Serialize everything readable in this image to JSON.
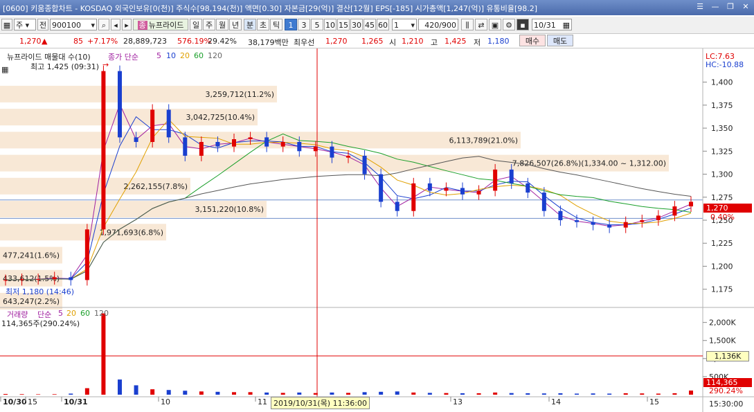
{
  "title": "[0600] 키움종합차트 - KOSDAQ 외국인보유[0(천)] 주식수[98,194(천)] 액면[0.30] 자본금[29(억)] 결산[12월] EPS[-185] 시가총액[1,247(억)] 유통비율[98.2]",
  "window_buttons": [
    "☰",
    "—",
    "❐",
    "✕"
  ],
  "toolbar": {
    "type_sel": "주",
    "prefix": "전",
    "code": "900100",
    "stock_name": "뉴프라이드",
    "period_tabs": [
      "일",
      "주",
      "월",
      "년",
      "분",
      "초",
      "틱"
    ],
    "numbers": [
      "1",
      "3",
      "5",
      "10",
      "15",
      "30",
      "45",
      "60"
    ],
    "count": "1",
    "range": "420/900",
    "date": "10/31"
  },
  "quote": {
    "price": "1,270",
    "change": "85",
    "rate": "+7.17%",
    "volume": "28,889,723",
    "vol_ratio": "576.19%",
    "turnover": "29.42%",
    "amount": "38,179백만",
    "best_label": "최우선",
    "bid": "1,270",
    "ask": "1,265",
    "open_lbl": "시",
    "open": "1,210",
    "high_lbl": "고",
    "high": "1,425",
    "low_lbl": "저",
    "low": "1,180",
    "buy": "매수",
    "sell": "매도"
  },
  "price_panel": {
    "legend_name": "뉴프라이드 매물대 수(10)",
    "ma_label": "종가 단순",
    "ma": [
      "5",
      "10",
      "20",
      "60",
      "120"
    ],
    "max_label": "최고 1,425 (09:31)",
    "min_label": "최저 1,180 (14:46)",
    "lc": "LC:7.63",
    "hc": "HC:-10.88",
    "last_price": "1,270",
    "last_rate": "0.40%",
    "volume_profile": [
      {
        "label": "3,259,712(11.2%)",
        "price": 1387
      },
      {
        "label": "3,042,725(10.4%)",
        "price": 1362
      },
      {
        "label": "6,113,789(21.0%)",
        "price": 1337
      },
      {
        "label": "7,826,507(26.8%)(1,334.00 ~ 1,312.00)",
        "price": 1312
      },
      {
        "label": "2,262,155(7.8%)",
        "price": 1287
      },
      {
        "label": "3,151,220(10.8%)",
        "price": 1262
      },
      {
        "label": "1,971,693(6.8%)",
        "price": 1237
      },
      {
        "label": "477,241(1.6%)",
        "price": 1212
      },
      {
        "label": "433,612(1.5%)",
        "price": 1187
      },
      {
        "label": "643,247(2.2%)",
        "price": 1162
      }
    ]
  },
  "volume_panel": {
    "legend_name": "거래량",
    "ma_label": "단순",
    "ma": [
      "5",
      "20",
      "60",
      "120"
    ],
    "current": "114,365주(290.24%)",
    "ref_value": "1,136K",
    "last_value": "114,365",
    "last_rate": "290.24%"
  },
  "crosshair_time": "2019/10/31(목) 11:36:00",
  "x_labels": [
    "10/30",
    "15",
    "10/31",
    "10",
    "11",
    "13",
    "14",
    "15"
  ],
  "x_right": "15:30:00",
  "chart_data": [
    {
      "type": "line",
      "title": "",
      "y_ticks": [
        1175,
        1200,
        1225,
        1250,
        1275,
        1300,
        1325,
        1350,
        1375,
        1400
      ],
      "ylim": [
        1162,
        1420
      ],
      "series": [
        {
          "name": "종가",
          "x": [
            0,
            10,
            20,
            30,
            40,
            50,
            60,
            70,
            80,
            90,
            100,
            110,
            120,
            130,
            140,
            150,
            160,
            170,
            180,
            190,
            200,
            210,
            220,
            230,
            240,
            250,
            260,
            270,
            280,
            290,
            300,
            310,
            320,
            330,
            340,
            350,
            360,
            370,
            380,
            390,
            400,
            410,
            420
          ],
          "values": [
            1185,
            1186,
            1186,
            1188,
            1185,
            1240,
            1412,
            1340,
            1335,
            1370,
            1340,
            1320,
            1335,
            1330,
            1338,
            1340,
            1330,
            1335,
            1325,
            1330,
            1318,
            1320,
            1300,
            1270,
            1260,
            1290,
            1282,
            1285,
            1278,
            1282,
            1305,
            1290,
            1280,
            1260,
            1250,
            1248,
            1245,
            1242,
            1248,
            1250,
            1255,
            1265,
            1270
          ]
        }
      ]
    },
    {
      "type": "bar",
      "title": "",
      "y_ticks": [
        500000,
        1000000,
        1500000,
        2000000
      ],
      "ylim": [
        0,
        2300000
      ],
      "series": [
        {
          "name": "거래량",
          "x": [
            0,
            10,
            20,
            30,
            40,
            50,
            60,
            70,
            80,
            90,
            100,
            110,
            120,
            130,
            140,
            150,
            160,
            170,
            180,
            190,
            200,
            210,
            220,
            230,
            240,
            250,
            260,
            270,
            280,
            290,
            300,
            310,
            320,
            330,
            340,
            350,
            360,
            370,
            380,
            390,
            400,
            410,
            420
          ],
          "values": [
            20000,
            15000,
            12000,
            14000,
            30000,
            180000,
            2250000,
            420000,
            260000,
            150000,
            130000,
            110000,
            90000,
            80000,
            70000,
            70000,
            60000,
            50000,
            60000,
            45000,
            60000,
            50000,
            70000,
            80000,
            90000,
            60000,
            50000,
            45000,
            40000,
            40000,
            60000,
            45000,
            40000,
            35000,
            40000,
            30000,
            35000,
            30000,
            40000,
            35000,
            30000,
            40000,
            114365
          ]
        }
      ]
    }
  ]
}
